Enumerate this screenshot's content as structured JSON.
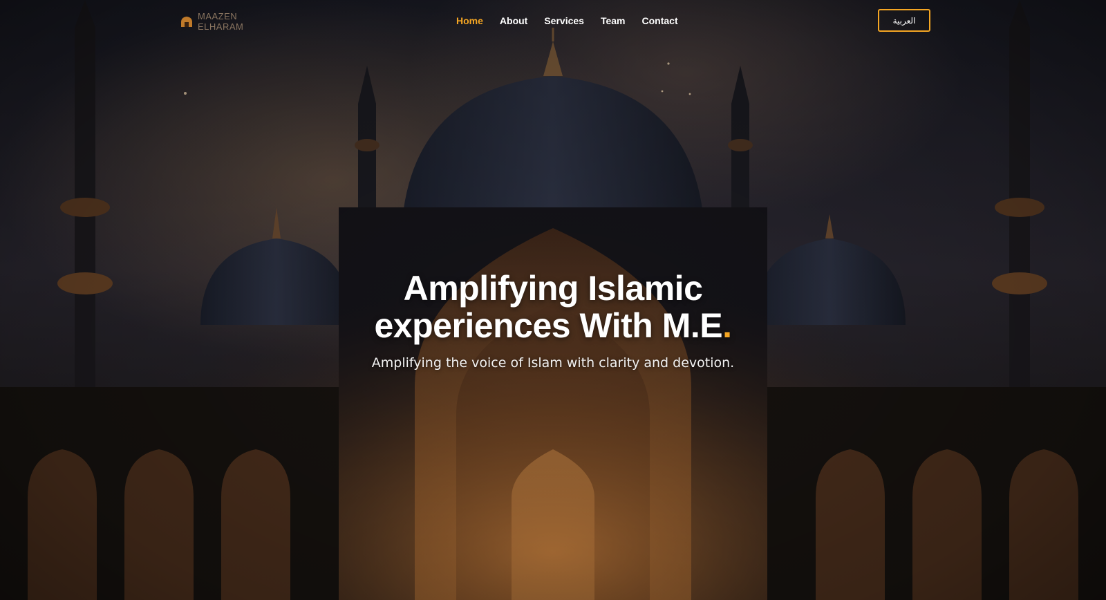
{
  "brand": {
    "logo_line1": "MAAZEN",
    "logo_line2": "ELHARAM",
    "logo_icon": "mosque-logo-icon",
    "accent_color": "#f5a623"
  },
  "nav": {
    "items": [
      {
        "label": "Home",
        "active": true
      },
      {
        "label": "About",
        "active": false
      },
      {
        "label": "Services",
        "active": false
      },
      {
        "label": "Team",
        "active": false
      },
      {
        "label": "Contact",
        "active": false
      }
    ],
    "language_button": "العربية"
  },
  "hero": {
    "title_line1": "Amplifying Islamic",
    "title_line2": "experiences With M.E",
    "title_dot": ".",
    "subtitle": "Amplifying the voice of Islam with clarity and devotion.",
    "background": "mosque-night-illustration"
  }
}
